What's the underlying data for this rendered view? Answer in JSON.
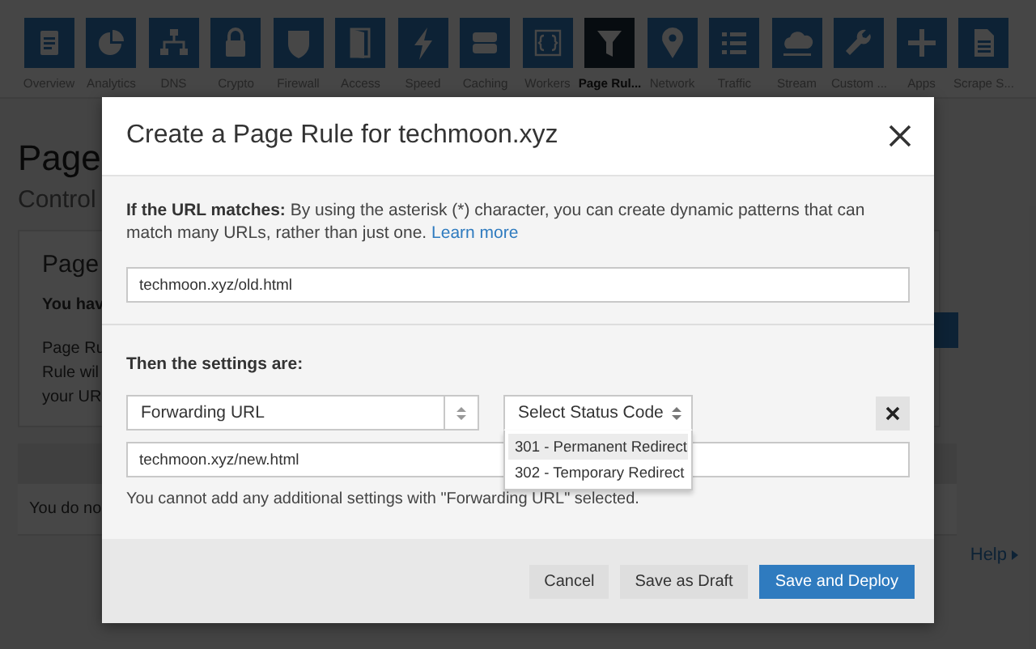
{
  "nav": [
    {
      "label": "Overview",
      "selected": false
    },
    {
      "label": "Analytics",
      "selected": false
    },
    {
      "label": "DNS",
      "selected": false
    },
    {
      "label": "Crypto",
      "selected": false
    },
    {
      "label": "Firewall",
      "selected": false
    },
    {
      "label": "Access",
      "selected": false
    },
    {
      "label": "Speed",
      "selected": false
    },
    {
      "label": "Caching",
      "selected": false
    },
    {
      "label": "Workers",
      "selected": false
    },
    {
      "label": "Page Rul...",
      "selected": true
    },
    {
      "label": "Network",
      "selected": false
    },
    {
      "label": "Traffic",
      "selected": false
    },
    {
      "label": "Stream",
      "selected": false
    },
    {
      "label": "Custom ...",
      "selected": false
    },
    {
      "label": "Apps",
      "selected": false
    },
    {
      "label": "Scrape S...",
      "selected": false
    }
  ],
  "page": {
    "title": "Page",
    "subtitle": "Control",
    "card": {
      "title": "Page",
      "notice": "You hav",
      "description": [
        "Page Ru",
        "Rule wil",
        "your UR"
      ]
    },
    "empty_message": "You do no",
    "help_link": "Help"
  },
  "modal": {
    "title": "Create a Page Rule for techmoon.xyz",
    "intro": "**If the URL matches:** By using the asterisk (*) character, you can create dynamic patterns that can match many URLs, rather than just one.",
    "learn_more": "Learn more",
    "url_field": {
      "value": "techmoon.xyz/old.html"
    },
    "settings_heading": "Then the settings are:",
    "setting_select": {
      "value": "Forwarding URL"
    },
    "status_select": {
      "placeholder": "Select Status Code",
      "expanded": true,
      "options": [
        {
          "label": "301 - Permanent Redirect",
          "selected": true
        },
        {
          "label": "302 - Temporary Redirect",
          "selected": false
        }
      ]
    },
    "destination_field": {
      "value": "techmoon.xyz/new.html"
    },
    "note": "You cannot add any additional settings with \"Forwarding URL\" selected.",
    "buttons": [
      {
        "label": "Cancel",
        "kind": "secondary"
      },
      {
        "label": "Save as Draft",
        "kind": "secondary"
      },
      {
        "label": "Save and Deploy",
        "kind": "primary"
      }
    ]
  }
}
